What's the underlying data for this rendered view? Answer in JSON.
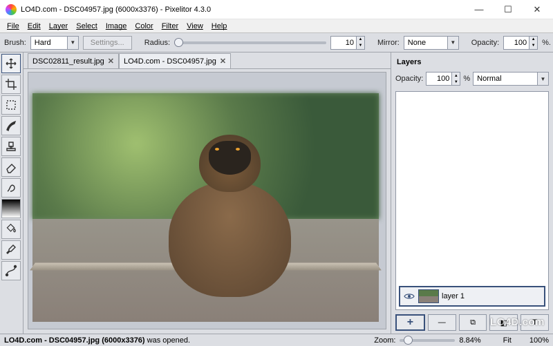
{
  "window": {
    "title": "LO4D.com - DSC04957.jpg (6000x3376) - Pixelitor 4.3.0",
    "btn_min": "—",
    "btn_max": "☐",
    "btn_close": "✕"
  },
  "menu": {
    "file": "File",
    "edit": "Edit",
    "layer": "Layer",
    "select": "Select",
    "image": "Image",
    "color": "Color",
    "filter": "Filter",
    "view": "View",
    "help": "Help"
  },
  "toolbar": {
    "brush_label": "Brush:",
    "brush_value": "Hard",
    "settings_label": "Settings...",
    "radius_label": "Radius:",
    "radius_value": "10",
    "mirror_label": "Mirror:",
    "mirror_value": "None",
    "opacity_label": "Opacity:",
    "opacity_value": "100",
    "percent": "%."
  },
  "tabs": [
    {
      "label": "DSC02811_result.jpg",
      "active": false
    },
    {
      "label": "LO4D.com - DSC04957.jpg",
      "active": true
    }
  ],
  "tools": [
    {
      "name": "move-tool",
      "icon": "move",
      "active": true
    },
    {
      "name": "crop-tool",
      "icon": "crop"
    },
    {
      "name": "marquee-tool",
      "icon": "marquee"
    },
    {
      "name": "brush-tool",
      "icon": "brush"
    },
    {
      "name": "stamp-tool",
      "icon": "stamp"
    },
    {
      "name": "eraser-tool",
      "icon": "eraser"
    },
    {
      "name": "smudge-tool",
      "icon": "smudge"
    },
    {
      "name": "gradient-tool",
      "icon": "gradient"
    },
    {
      "name": "bucket-tool",
      "icon": "bucket"
    },
    {
      "name": "eyedropper-tool",
      "icon": "eyedropper"
    },
    {
      "name": "path-tool",
      "icon": "path"
    }
  ],
  "layers": {
    "title": "Layers",
    "opacity_label": "Opacity:",
    "opacity_value": "100",
    "percent": "%",
    "blend_value": "Normal",
    "item_name": "layer 1",
    "btn_add": "+",
    "btn_del": "—",
    "btn_dup": "⧉",
    "btn_mask": "◧",
    "btn_text": "T"
  },
  "status": {
    "message": "LO4D.com - DSC04957.jpg (6000x3376) was opened.",
    "zoom_label": "Zoom:",
    "zoom_pct": "8.84%",
    "fit": "Fit",
    "hundred": "100%"
  },
  "watermark": "LO4D.com"
}
